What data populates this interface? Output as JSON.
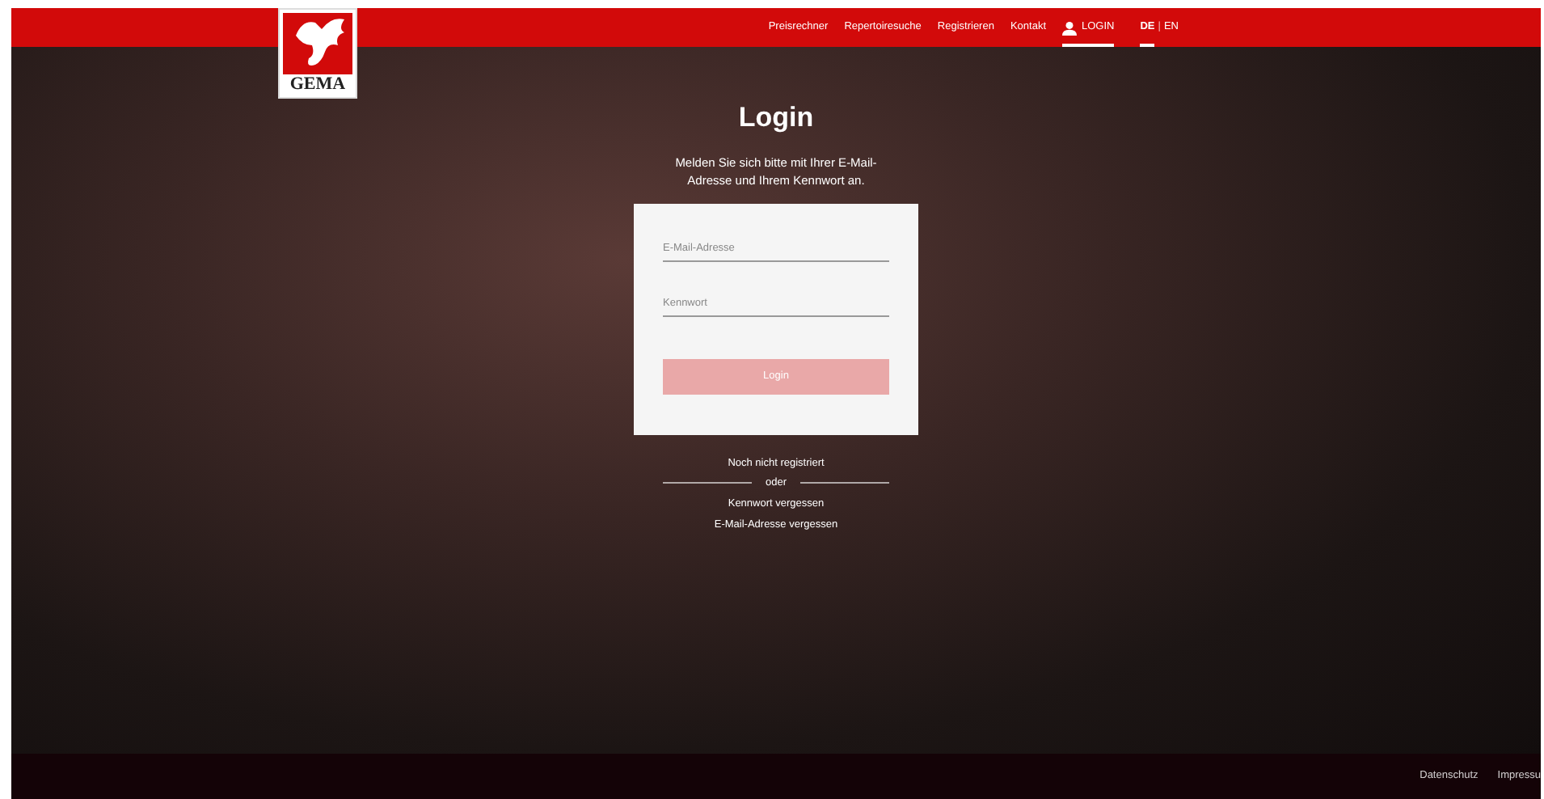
{
  "header": {
    "logo_text": "GEMA",
    "nav": [
      {
        "label": "Preisrechner",
        "selected": false
      },
      {
        "label": "Repertoiresuche",
        "selected": false
      },
      {
        "label": "Registrieren",
        "selected": false
      },
      {
        "label": "Kontakt",
        "selected": false
      },
      {
        "label": "LOGIN",
        "selected": true
      }
    ],
    "languages": [
      {
        "label": "DE",
        "selected": true
      },
      {
        "label": "EN",
        "selected": false
      }
    ],
    "language_separator": "|"
  },
  "login": {
    "title": "Login",
    "intro": "Melden Sie sich bitte mit Ihrer E-Mail-Adresse und Ihrem Kennwort an.",
    "fields": [
      {
        "placeholder": "E-Mail-Adresse"
      },
      {
        "placeholder": "Kennwort"
      }
    ],
    "button": {
      "label": "Login",
      "disabled": true
    },
    "register_link": "Noch nicht registriert",
    "divider": "oder",
    "links": [
      "Kennwort vergessen",
      "E-Mail-Adresse vergessen"
    ]
  },
  "footer": {
    "links": [
      "Datenschutz",
      "Impressu"
    ]
  }
}
